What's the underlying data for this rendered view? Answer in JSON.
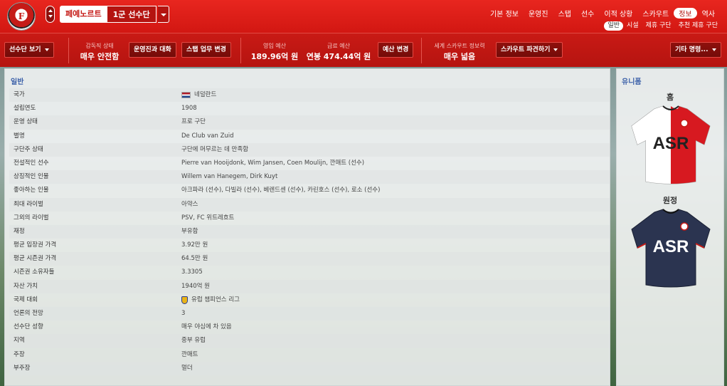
{
  "header": {
    "crest_text": "F",
    "club_name": "페예노르트",
    "team_name": "1군 선수단",
    "nav": [
      "기본 정보",
      "운영진",
      "스탭",
      "선수",
      "이적 상황",
      "스카우트",
      "정보",
      "역사"
    ],
    "nav_active": 6,
    "subnav": [
      "일반",
      "시설",
      "제휴 구단",
      "추천 제휴 구단"
    ],
    "subnav_active": 0
  },
  "infobar": {
    "squad_view_btn": "선수단 보기",
    "manager_status_label": "감독직 상태",
    "manager_status_value": "매우 안전함",
    "board_talk_btn": "운영진과 대화",
    "staff_duty_btn": "스탭 업무 변경",
    "transfer_budget_label": "영입 예산",
    "transfer_budget_value": "189.96억 원",
    "wage_budget_label": "급료 예산",
    "wage_budget_value": "연봉 474.44억 원",
    "budget_change_btn": "예산 변경",
    "scout_knowledge_label": "세계 스카우트 정보력",
    "scout_knowledge_value": "매우 넓음",
    "scout_dispatch_btn": "스카우트 파견하기",
    "other_commands_btn": "기타 명령..."
  },
  "general": {
    "title": "일반",
    "rows": [
      {
        "label": "국가",
        "value": "네덜란드"
      },
      {
        "label": "설립연도",
        "value": "1908"
      },
      {
        "label": "운영 상태",
        "value": "프로 구단"
      },
      {
        "label": "별명",
        "value": "De Club van Zuid"
      },
      {
        "label": "구단주 상태",
        "value": "구단에 머무르는 데 만족함"
      },
      {
        "label": "전설적인 선수",
        "value": "Pierre van Hooijdonk, Wim Jansen, Coen Moulijn, 깐매트 (선수)"
      },
      {
        "label": "상징적인 인물",
        "value": "Willem van Hanegem, Dirk Kuyt"
      },
      {
        "label": "좋아하는 인물",
        "value": "아크파라 (선수), 다빌라 (선수), 베렌드센 (선수), 카린호스 (선수), 로소 (선수)"
      },
      {
        "label": "최대 라이벌",
        "value": "아약스"
      },
      {
        "label": "그외의 라이벌",
        "value": "PSV, FC 위트레흐트"
      },
      {
        "label": "재정",
        "value": "부유함"
      },
      {
        "label": "평균 입장권 가격",
        "value": "3.92만 원"
      },
      {
        "label": "평균 시즌권 가격",
        "value": "64.5만 원"
      },
      {
        "label": "시즌권 소유자들",
        "value": "3.3305"
      },
      {
        "label": "자산 가치",
        "value": "1940억 원"
      },
      {
        "label": "국제 대회",
        "value": "유럽 챔피언스 리그"
      },
      {
        "label": "언론의 전망",
        "value": "3"
      },
      {
        "label": "선수단 성향",
        "value": "매우 야심에 차 있음"
      },
      {
        "label": "지역",
        "value": "중부 유럽"
      },
      {
        "label": "주장",
        "value": "깐매트"
      },
      {
        "label": "부주장",
        "value": "멀더"
      }
    ]
  },
  "kits": {
    "title": "유니폼",
    "home_label": "홈",
    "away_label": "원정",
    "sponsor": "ASR"
  }
}
